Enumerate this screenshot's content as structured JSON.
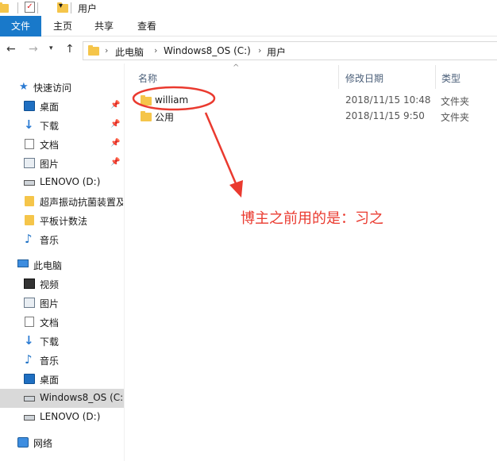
{
  "window": {
    "title": "用户"
  },
  "ribbon": {
    "tabs": [
      "文件",
      "主页",
      "共享",
      "查看"
    ]
  },
  "address": {
    "crumbs": [
      "此电脑",
      "Windows8_OS (C:)",
      "用户"
    ]
  },
  "sidebar": {
    "quick_access": {
      "label": "快速访问",
      "items": [
        {
          "label": "桌面",
          "icon": "desktop-icon",
          "pinned": true
        },
        {
          "label": "下载",
          "icon": "download-icon",
          "pinned": true
        },
        {
          "label": "文档",
          "icon": "document-icon",
          "pinned": true
        },
        {
          "label": "图片",
          "icon": "picture-icon",
          "pinned": true
        },
        {
          "label": "LENOVO (D:)",
          "icon": "drive-icon",
          "pinned": false
        },
        {
          "label": "超声振动抗菌装置及",
          "icon": "folder-icon",
          "pinned": false
        },
        {
          "label": "平板计数法",
          "icon": "folder-icon",
          "pinned": false
        },
        {
          "label": "音乐",
          "icon": "music-icon",
          "pinned": false
        }
      ]
    },
    "this_pc": {
      "label": "此电脑",
      "items": [
        {
          "label": "视频",
          "icon": "video-icon"
        },
        {
          "label": "图片",
          "icon": "picture-icon"
        },
        {
          "label": "文档",
          "icon": "document-icon"
        },
        {
          "label": "下载",
          "icon": "download-icon"
        },
        {
          "label": "音乐",
          "icon": "music-icon"
        },
        {
          "label": "桌面",
          "icon": "desktop-icon"
        },
        {
          "label": "Windows8_OS (C:)",
          "icon": "drive-icon",
          "selected": true
        },
        {
          "label": "LENOVO (D:)",
          "icon": "drive-icon"
        }
      ]
    },
    "network": {
      "label": "网络",
      "icon": "network-icon"
    }
  },
  "list": {
    "columns": {
      "name": "名称",
      "modified": "修改日期",
      "type": "类型"
    },
    "rows": [
      {
        "name": "william",
        "modified": "2018/11/15 10:48",
        "type": "文件夹"
      },
      {
        "name": "公用",
        "modified": "2018/11/15 9:50",
        "type": "文件夹"
      }
    ]
  },
  "annotation": {
    "text": "博主之前用的是：习之",
    "color": "#ea3a2f"
  }
}
